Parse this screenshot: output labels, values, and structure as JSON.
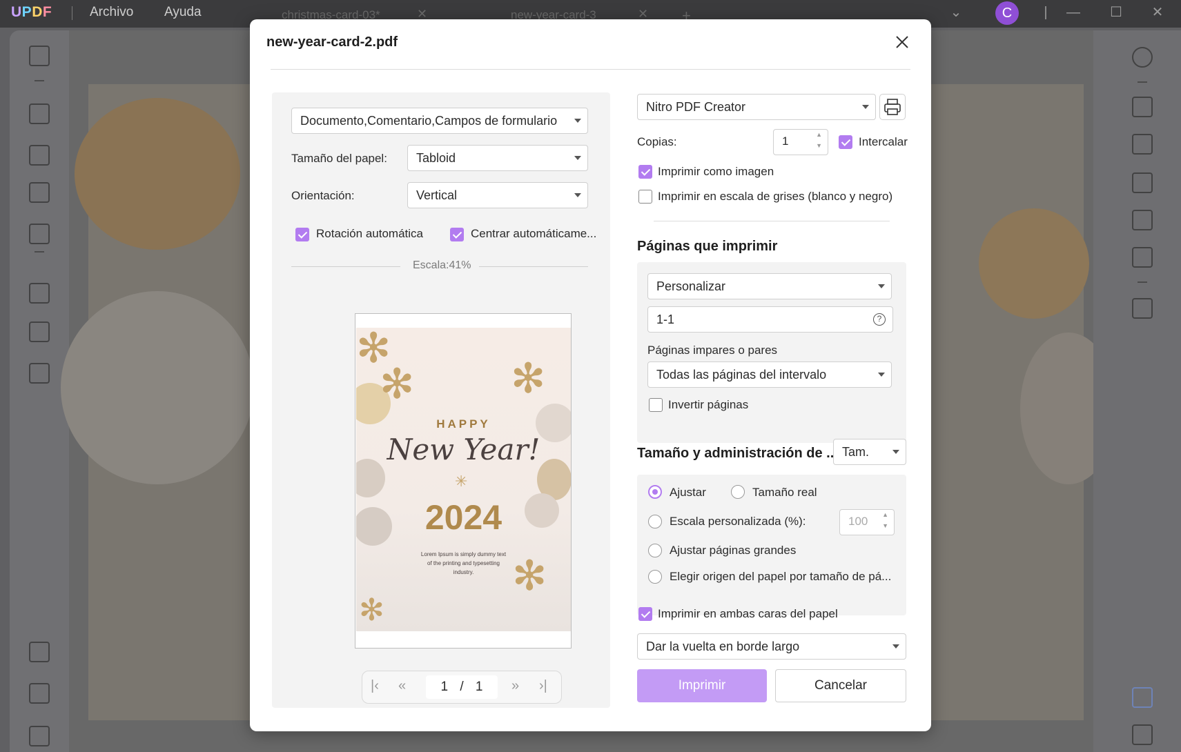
{
  "app": {
    "logo": "UPDF",
    "menu": [
      "Archivo",
      "Ayuda"
    ],
    "tabs": [
      {
        "label": "christmas-card-03*"
      },
      {
        "label": "new-year-card-3"
      }
    ],
    "new_tab": "+",
    "avatar_letter": "C",
    "accent_color": "#b27cf0"
  },
  "dialog": {
    "title": "new-year-card-2.pdf",
    "content_select": "Documento,Comentario,Campos de formulario",
    "paper_size_label": "Tamaño del papel:",
    "paper_size_value": "Tabloid",
    "orientation_label": "Orientación:",
    "orientation_value": "Vertical",
    "auto_rotate_label": "Rotación automática",
    "auto_rotate_checked": true,
    "auto_center_label": "Centrar automáticame...",
    "auto_center_checked": true,
    "scale_text": "Escala:41%",
    "preview_card": {
      "happy": "HAPPY",
      "new_year": "New Year!",
      "year": "2024",
      "body": "Lorem Ipsum is simply dummy text of the printing and typesetting industry."
    },
    "pager": {
      "current": "1",
      "separator": "/",
      "total": "1"
    },
    "printer": "Nitro PDF Creator",
    "copies_label": "Copias:",
    "copies_value": "1",
    "collate_label": "Intercalar",
    "collate_checked": true,
    "print_as_image_label": "Imprimir como imagen",
    "print_as_image_checked": true,
    "grayscale_label": "Imprimir en escala de grises (blanco y negro)",
    "grayscale_checked": false,
    "pages_heading": "Páginas que imprimir",
    "pages_mode": "Personalizar",
    "pages_range": "1-1",
    "odd_even_label": "Páginas impares o pares",
    "odd_even_value": "Todas las páginas del intervalo",
    "reverse_label": "Invertir páginas",
    "reverse_checked": false,
    "size_heading": "Tamaño y administración de ..",
    "size_select": "Tam.",
    "size_options": {
      "fit": "Ajustar",
      "actual": "Tamaño real",
      "custom": "Escala personalizada (%):",
      "custom_value": "100",
      "shrink": "Ajustar páginas grandes",
      "source": "Elegir origen del papel por tamaño de pá..."
    },
    "size_selected": "fit",
    "duplex_label": "Imprimir en ambas caras del papel",
    "duplex_checked": true,
    "duplex_mode": "Dar la vuelta en borde largo",
    "print_button": "Imprimir",
    "cancel_button": "Cancelar"
  }
}
